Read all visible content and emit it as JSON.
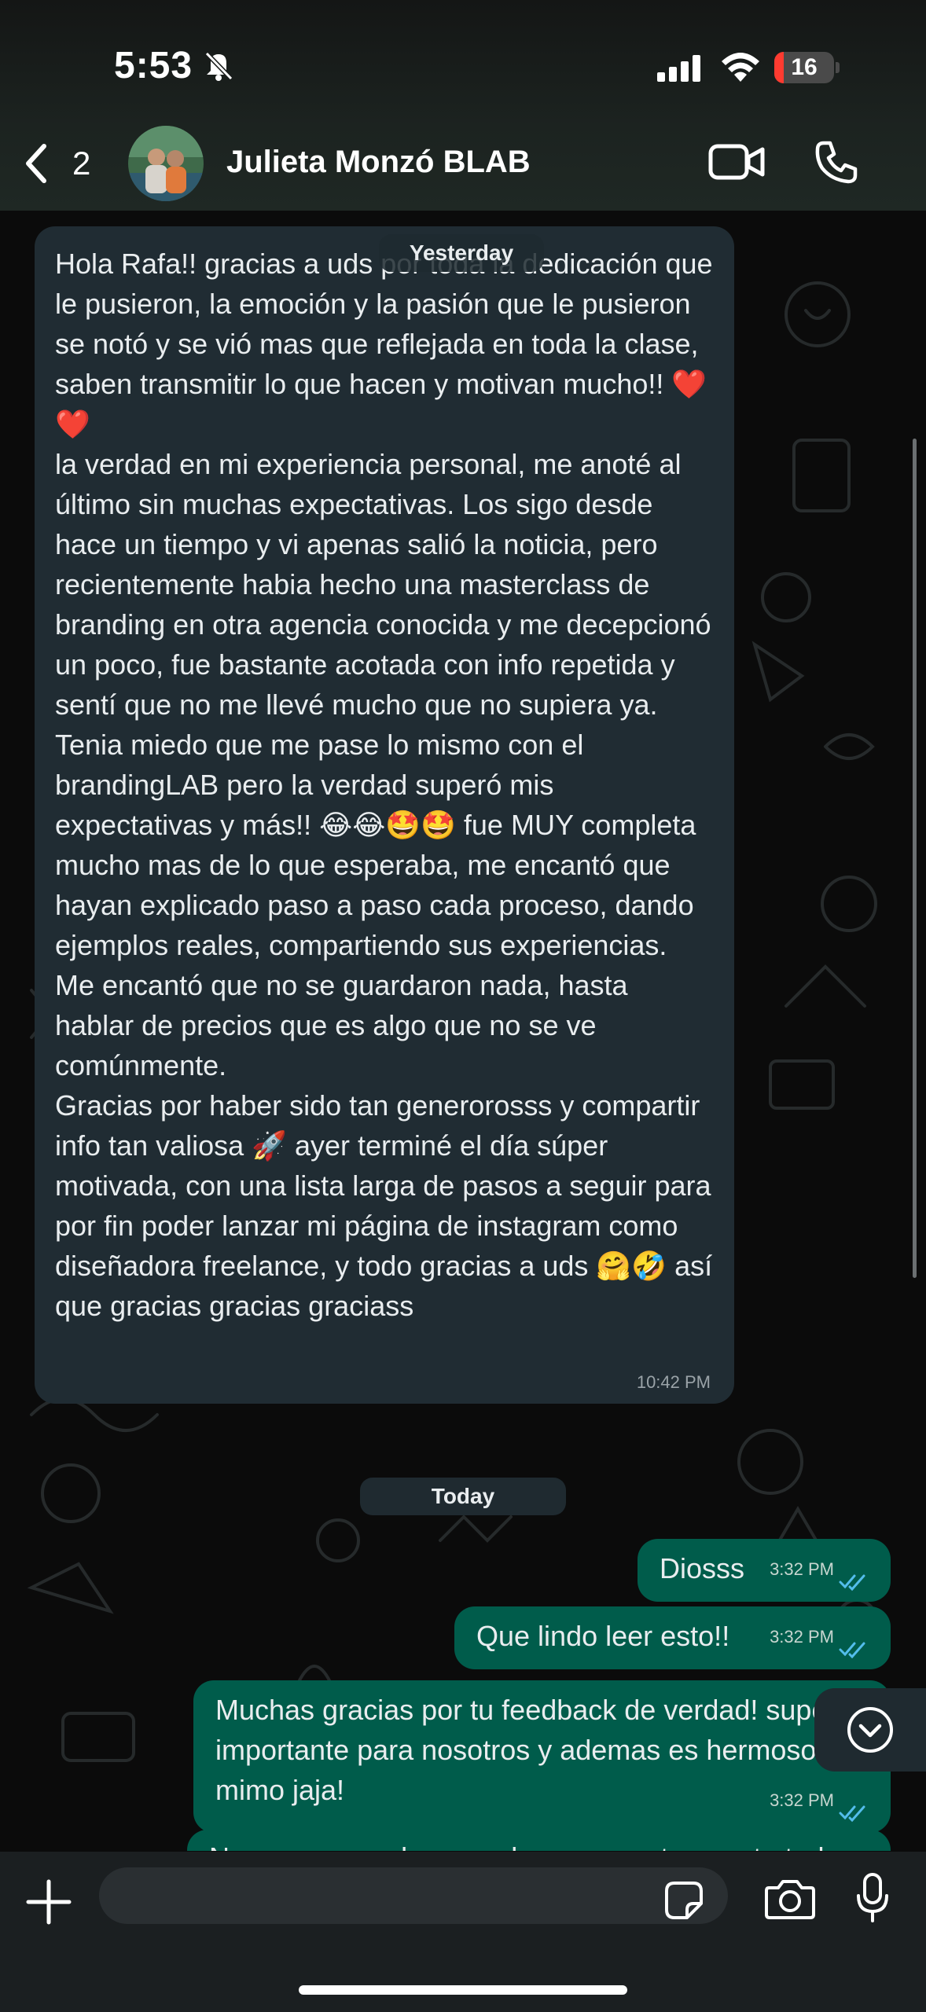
{
  "status_bar": {
    "time": "5:53",
    "battery_level": "16",
    "battery_fraction": 0.16,
    "icons": [
      "bell-off-icon",
      "signal-icon",
      "wifi-icon",
      "battery-icon"
    ]
  },
  "header": {
    "back_count": "2",
    "contact_name": "Julieta Monzó BLAB",
    "icons": [
      "chevron-left-icon",
      "video-call-icon",
      "phone-icon"
    ]
  },
  "chat": {
    "yesterday_label": "Yesterday",
    "incoming_message": "Hola Rafa!! gracias a uds por toda la dedicación que le pusieron, la emoción y la pasión que le pusieron se notó y se vió mas que reflejada en toda la clase, saben transmitir lo que hacen y motivan mucho!! ❤️ ❤️\nla verdad en mi experiencia personal, me anoté al último sin muchas expectativas. Los sigo desde hace un tiempo y vi apenas salió la noticia, pero recientemente habia hecho una masterclass de branding en otra agencia conocida y me decepcionó un poco, fue bastante acotada con info repetida y sentí que no me llevé mucho que no supiera ya. Tenia miedo que me pase lo mismo con el brandingLAB pero la verdad superó mis expectativas y más!! 😂😂🤩🤩 fue MUY completa mucho mas de lo que esperaba, me encantó que hayan explicado paso a paso cada proceso, dando ejemplos reales, compartiendo sus experiencias. Me encantó que no se guardaron nada, hasta hablar de precios que es algo que no se ve comúnmente.\nGracias por haber sido tan generorosss y compartir info tan valiosa 🚀 ayer terminé el día súper motivada, con una lista larga de pasos a seguir para por fin poder lanzar mi página de instagram como diseñadora freelance, y todo gracias a uds 🤗🤣 así que gracias gracias graciass",
    "incoming_time": "10:42 PM",
    "today_label": "Today",
    "outgoing": [
      {
        "text": "Diosss",
        "time": "3:32 PM"
      },
      {
        "text": "Que lindo leer esto!!",
        "time": "3:32 PM"
      },
      {
        "text": "Muchas gracias por tu feedback de verdad! super importante para nosotros y ademas es hermoso mimo jaja!",
        "time": "3:32 PM"
      },
      {
        "text": "Nos ponemos de acuerdo para que te cuente todo",
        "time": ""
      }
    ]
  },
  "input_bar": {
    "placeholder": "",
    "icons": [
      "plus-icon",
      "sticker-icon",
      "camera-icon",
      "microphone-icon"
    ]
  },
  "colors": {
    "incoming_bubble": "#202c33",
    "outgoing_bubble": "#005c4b",
    "read_ticks": "#53bdeb",
    "battery_low": "#ff3b30"
  }
}
